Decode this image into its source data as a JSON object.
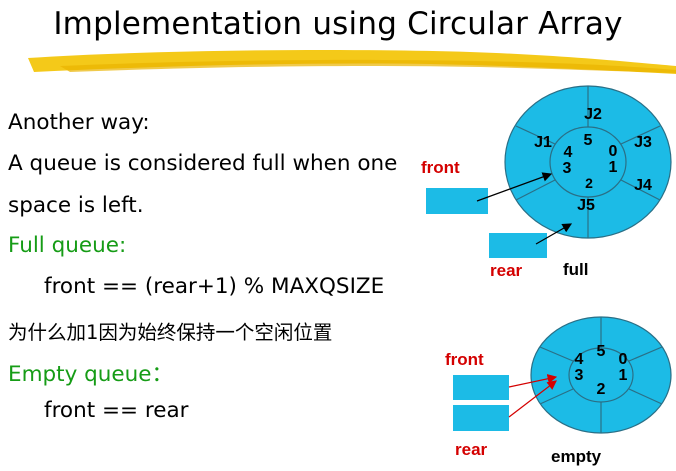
{
  "title": "Implementation using Circular Array",
  "body": {
    "line1": "Another way:",
    "line2": "A queue is considered full when one",
    "line3": "space is left.",
    "line4": "Full queue:",
    "line5": "front == (rear+1) % MAXQSIZE",
    "line6": "为什么加1因为始终保持一个空闲位置",
    "line7": "Empty queue：",
    "line8": "front == rear"
  },
  "full_diagram": {
    "front_label": "front",
    "rear_label": "rear",
    "caption": "full",
    "elements": [
      "J1",
      "J2",
      "J3",
      "J4",
      "J5"
    ],
    "indices": [
      "0",
      "1",
      "2",
      "3",
      "4",
      "5"
    ]
  },
  "empty_diagram": {
    "front_label": "front",
    "rear_label": "rear",
    "caption": "empty",
    "indices": [
      "0",
      "1",
      "2",
      "3",
      "4",
      "5"
    ]
  },
  "colors": {
    "fill": "#1cbbe6",
    "text_green": "#169c16",
    "label_red": "#d40000",
    "title_bar": "#f3c300"
  }
}
